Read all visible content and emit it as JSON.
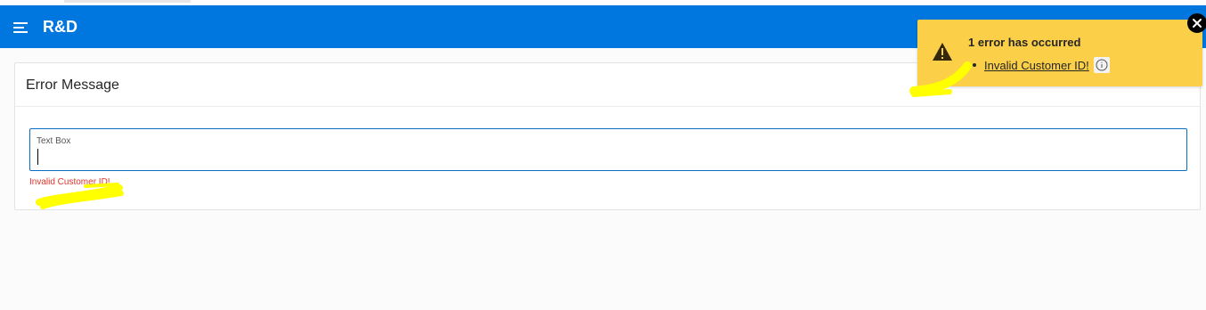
{
  "header": {
    "app_title": "R&D"
  },
  "region": {
    "title": "Error Message",
    "field": {
      "label": "Text Box",
      "value": ""
    },
    "inline_error": "Invalid Customer ID!"
  },
  "notification": {
    "title": "1 error has occurred",
    "errors": [
      {
        "message": "Invalid Customer ID!"
      }
    ]
  },
  "colors": {
    "header_bg": "#0076df",
    "notification_bg": "#fbcf47",
    "error_text": "#e0332a",
    "field_border": "#0a6fc4",
    "highlighter": "#ffff00"
  },
  "icons": {
    "menu": "hamburger-icon",
    "warning": "warning-triangle-icon",
    "info": "info-circle-icon",
    "close": "close-icon"
  }
}
